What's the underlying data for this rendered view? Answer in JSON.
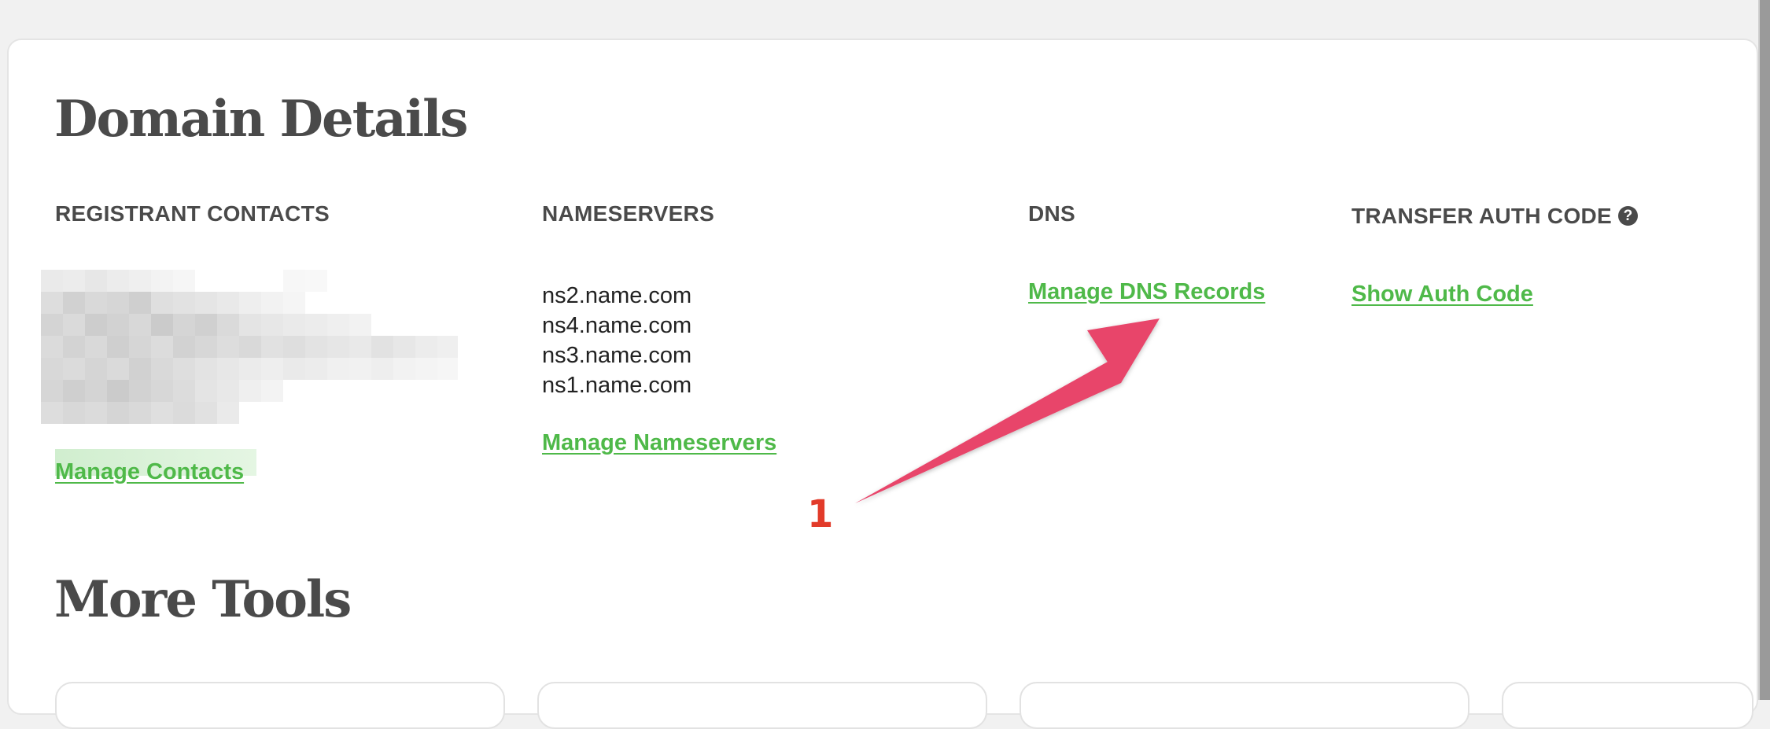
{
  "page": {
    "title": "Domain Details",
    "more_tools_title": "More Tools"
  },
  "columns": {
    "registrant": {
      "heading": "REGISTRANT CONTACTS",
      "link": "Manage Contacts"
    },
    "nameservers": {
      "heading": "NAMESERVERS",
      "items": [
        "ns2.name.com",
        "ns4.name.com",
        "ns3.name.com",
        "ns1.name.com"
      ],
      "link": "Manage Nameservers"
    },
    "dns": {
      "heading": "DNS",
      "link": "Manage DNS Records"
    },
    "transfer": {
      "heading": "TRANSFER AUTH CODE",
      "help_icon": "question-circle-icon",
      "help_glyph": "?",
      "link": "Show Auth Code"
    }
  },
  "annotation": {
    "number": "1",
    "arrow_color": "#e8456b",
    "number_color": "#e23b2a"
  },
  "colors": {
    "link": "#4fb949",
    "heading": "#4a4a4a",
    "background": "#f1f1f1",
    "card": "#ffffff"
  }
}
